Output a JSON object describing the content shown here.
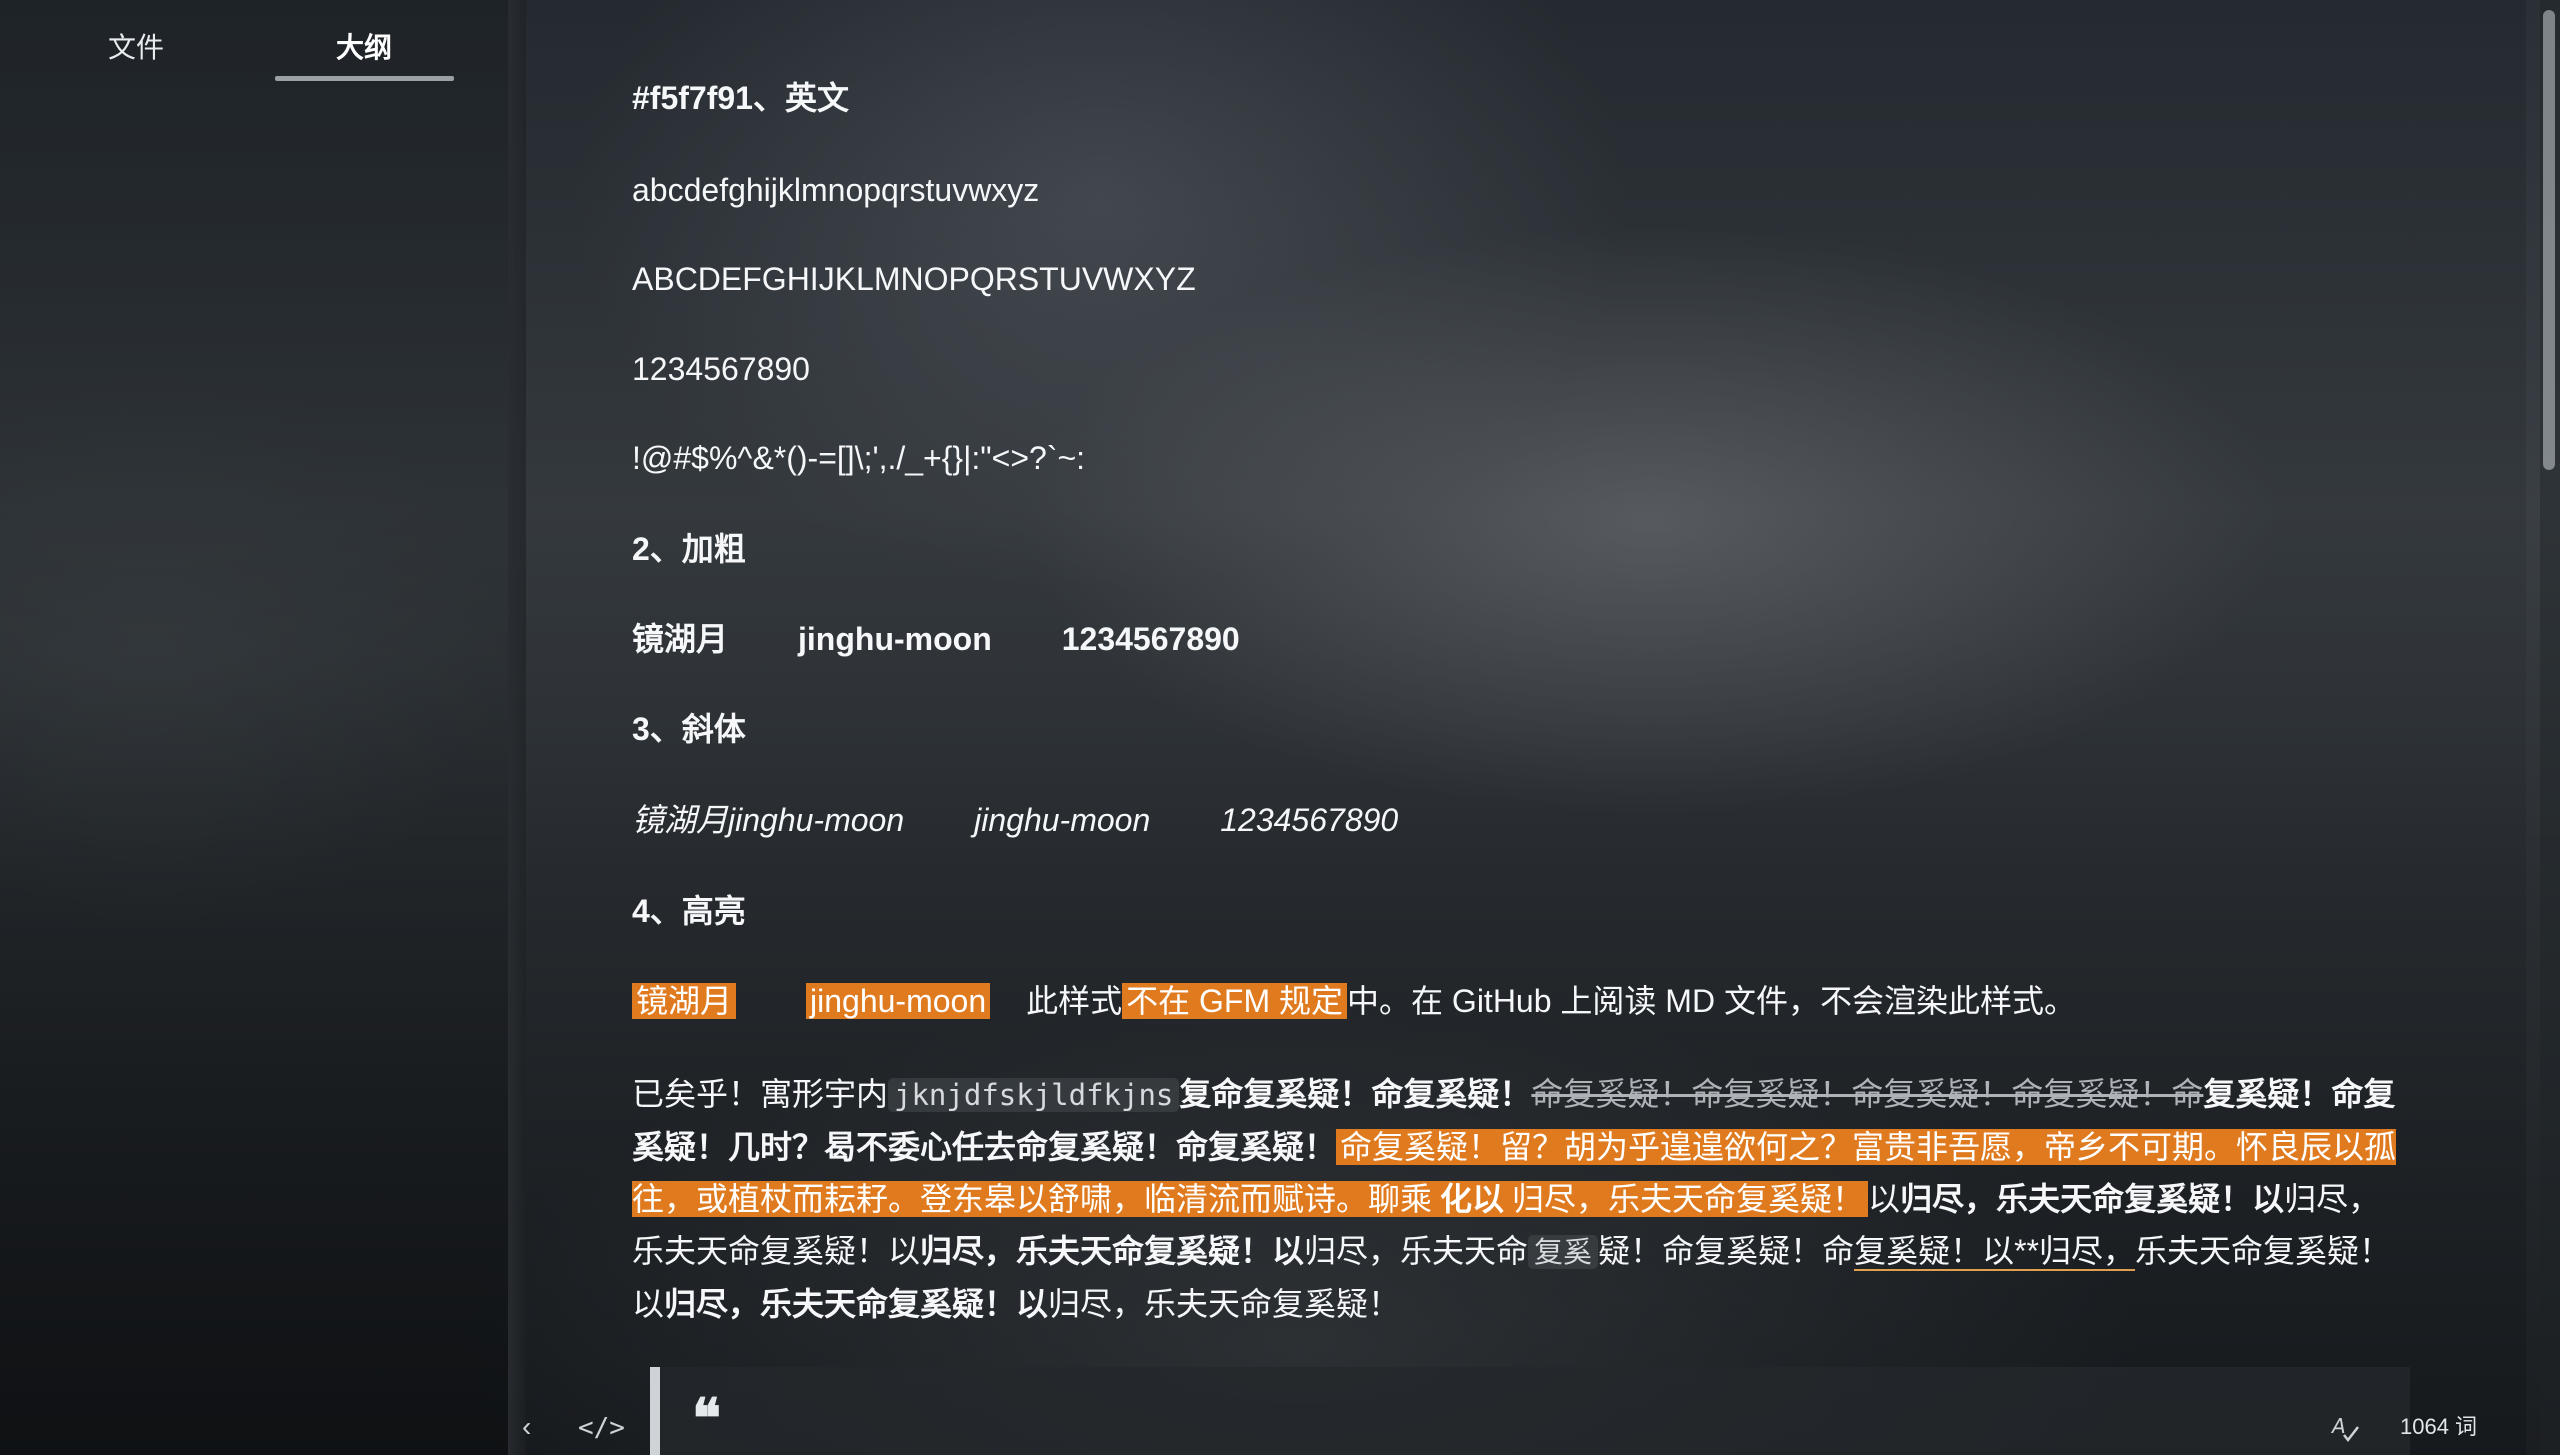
{
  "sidebar": {
    "tabs": [
      {
        "label": "文件"
      },
      {
        "label": "大纲"
      }
    ]
  },
  "content": {
    "heading_colors": "#f5f7f91、英文",
    "lowercase": "abcdefghijklmnopqrstuvwxyz",
    "uppercase": "ABCDEFGHIJKLMNOPQRSTUVWXYZ",
    "digits": "1234567890",
    "symbols": "!@#$%^&*()-=[]\\;',./_+{}|:\"<>?`~:",
    "h_bold": "2、加粗",
    "bold_items": [
      "镜湖月",
      "jinghu-moon",
      "1234567890"
    ],
    "h_italic": "3、斜体",
    "italic_items": [
      "镜湖月jinghu-moon",
      "jinghu-moon",
      "1234567890"
    ],
    "h_highlight": "4、高亮",
    "highlight_line": {
      "hl1": "镜湖月",
      "hl2": "jinghu-moon",
      "pre": "此样式",
      "hl3": "不在 GFM 规定",
      "post": "中。在 GitHub 上阅读 MD 文件，不会渲染此样式。"
    },
    "paragraph": {
      "p1": "已矣乎！寓形宇内",
      "code1": "jknjdfskjldfkjns",
      "p2": "复命复奚疑！命复奚疑！",
      "strike": "命复奚疑！命复奚疑！命复奚疑！命复奚疑！命",
      "p3": "复奚疑！命复奚疑！几时？曷不委心任去命复奚疑！命复奚疑！",
      "hl": "命复奚疑！留？胡为乎遑遑欲何之？富贵非吾愿，帝乡不可期。怀良辰以孤往，或植杖而耘耔。登东皋以舒啸，临清流而赋诗。聊乘",
      "hl_bold": "化以",
      "hl_tail": "归尽，乐夫天命复奚疑！",
      "p4": "以",
      "b1": "归尽，乐夫天命复奚疑！以",
      "p5": "归尽，乐夫天命复奚疑！以",
      "b2": "归尽，乐夫天命复奚疑！以",
      "p6": "归尽，乐夫天命",
      "code2": "复奚",
      "p7": "疑！命复奚疑！命",
      "ul": "复奚疑！以**归尽，",
      "p8": "乐夫天命复奚疑！以",
      "b3": "归尽，乐夫天命复奚疑！以",
      "p9": "归尽，乐夫天命复奚疑！"
    }
  },
  "quote": {
    "mark": "❝"
  },
  "footer": {
    "back_icon": "‹",
    "source_icon": "</>",
    "word_count": "1064 词"
  }
}
